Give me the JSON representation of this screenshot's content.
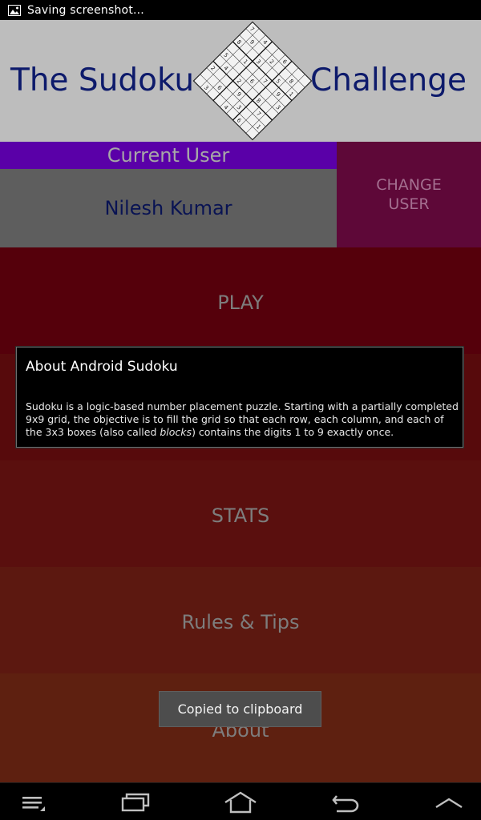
{
  "status_bar": {
    "notification_icon": "image-icon",
    "notification_text": "Saving screenshot..."
  },
  "header": {
    "title_left": "The Sudoku",
    "title_right": "Challenge",
    "logo_icon": "sudoku-grid-icon",
    "colors": {
      "background": "#bdbdbd",
      "title": "#0d1a6b"
    }
  },
  "user": {
    "current_user_label": "Current User",
    "user_name": "Nilesh Kumar",
    "change_user_line1": "CHANGE",
    "change_user_line2": "USER"
  },
  "menu": {
    "play": "PLAY",
    "stats": "STATS",
    "rules": "Rules & Tips",
    "about": "About"
  },
  "dialog": {
    "title": "About Android Sudoku",
    "body_before": "Sudoku is a logic-based number placement puzzle. Starting with a partially completed 9x9 grid, the objective is to fill the grid so that each row, each column, and each of the 3x3 boxes (also called ",
    "body_italic": "blocks",
    "body_after": ") contains the digits 1 to 9 exactly once."
  },
  "toast": {
    "text": "Copied to clipboard"
  },
  "nav_bar": {
    "icons": [
      "menu-icon",
      "recent-apps-icon",
      "home-icon",
      "back-icon",
      "up-chevron-icon"
    ]
  }
}
